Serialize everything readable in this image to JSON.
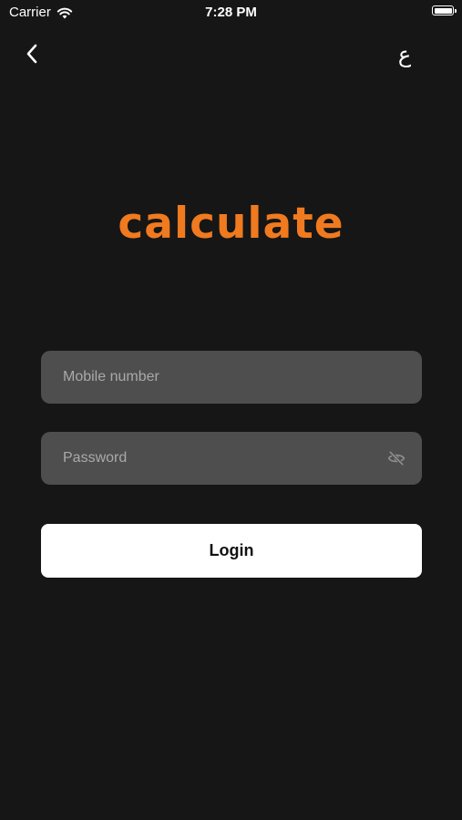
{
  "status_bar": {
    "carrier": "Carrier",
    "time": "7:28 PM",
    "icons": [
      "wifi-icon",
      "battery-icon"
    ]
  },
  "nav": {
    "back_icon": "chevron-left-icon",
    "language_label": "ع"
  },
  "logo": {
    "text": "calculate",
    "color": "#f07a1f"
  },
  "form": {
    "mobile_placeholder": "Mobile number",
    "mobile_value": "",
    "password_placeholder": "Password",
    "password_value": "",
    "password_toggle_icon": "eye-slash-icon",
    "login_label": "Login"
  },
  "colors": {
    "background": "#161616",
    "field": "#4e4e4e",
    "button": "#ffffff",
    "accent": "#f07a1f"
  }
}
